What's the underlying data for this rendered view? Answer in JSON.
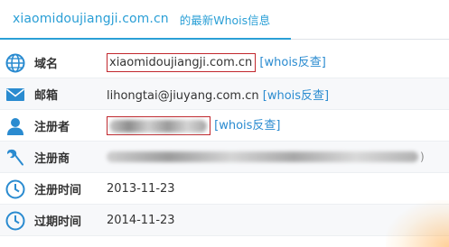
{
  "header": {
    "domain": "xiaomidoujiangji.com.cn",
    "title_suffix": "的最新Whois信息"
  },
  "rows": [
    {
      "icon": "globe-icon",
      "label": "域名",
      "value": "xiaomidoujiangji.com.cn",
      "link": "[whois反查]"
    },
    {
      "icon": "envelope-icon",
      "label": "邮箱",
      "value": "lihongtai@jiuyang.com.cn",
      "link": "[whois反查]"
    },
    {
      "icon": "user-icon",
      "label": "注册者",
      "value_redacted": true,
      "link": "[whois反查]"
    },
    {
      "icon": "wrench-icon",
      "label": "注册商",
      "value_redacted": true,
      "trailing": ")"
    },
    {
      "icon": "clock-icon",
      "label": "注册时间",
      "value": "2013-11-23"
    },
    {
      "icon": "clock-icon",
      "label": "过期时间",
      "value": "2014-11-23"
    }
  ],
  "colors": {
    "accent": "#2a9fd6",
    "link": "#2a8bd0",
    "highlight_box": "#c1272d",
    "icon": "#2a8bd0"
  }
}
